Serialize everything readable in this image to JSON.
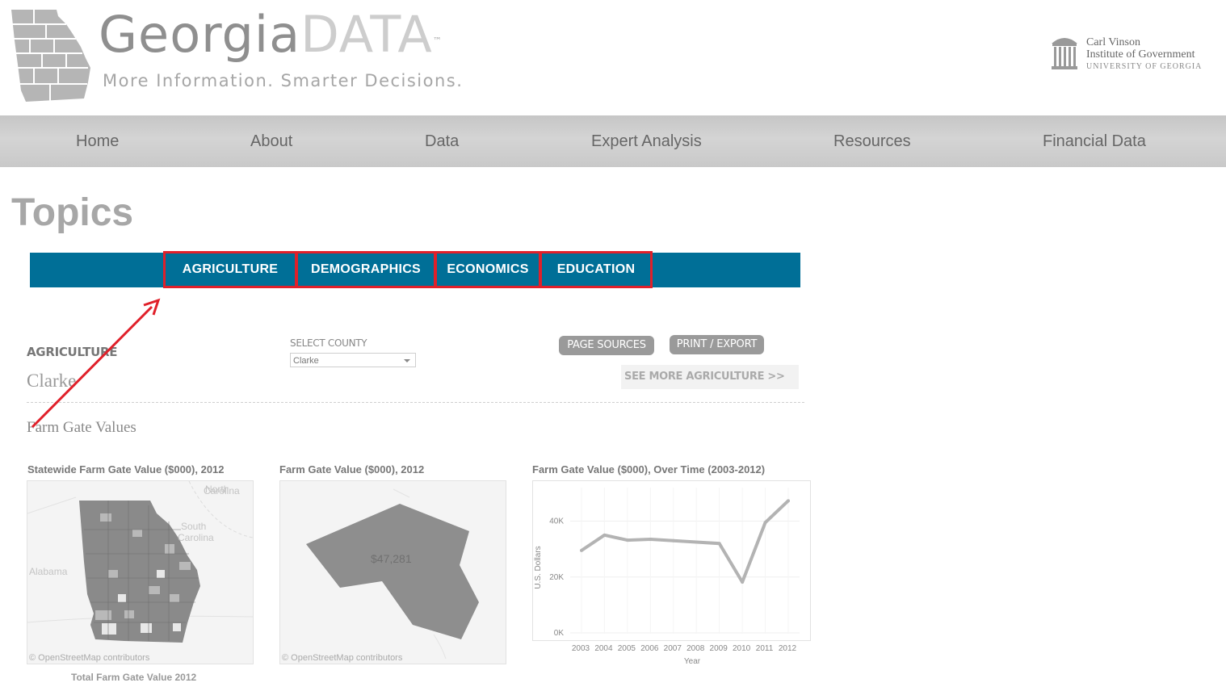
{
  "header": {
    "logo_georgia": "Georgia",
    "logo_data": "DATA",
    "logo_tm": "™",
    "tagline": "More Information. Smarter Decisions.",
    "partner_line1": "Carl Vinson",
    "partner_line2": "Institute of Government",
    "partner_line3": "UNIVERSITY OF GEORGIA"
  },
  "nav": {
    "items": [
      "Home",
      "About",
      "Data",
      "Expert Analysis",
      "Resources",
      "Financial Data"
    ]
  },
  "page_title": "Topics",
  "topic_tabs": [
    "AGRICULTURE",
    "DEMOGRAPHICS",
    "ECONOMICS",
    "EDUCATION"
  ],
  "section": {
    "label": "AGRICULTURE",
    "county": "Clarke",
    "select_label": "SELECT COUNTY",
    "select_value": "Clarke",
    "page_sources": "PAGE SOURCES",
    "print_export": "PRINT / EXPORT",
    "see_more": "SEE MORE AGRICULTURE >>",
    "farm_title": "Farm Gate Values"
  },
  "charts": {
    "statewide_title": "Statewide Farm Gate Value ($000), 2012",
    "county_title": "Farm Gate Value ($000), 2012",
    "time_title": "Farm Gate Value ($000), Over Time (2003-2012)",
    "osm_credit": "© OpenStreetMap contributors",
    "county_value": "$47,281",
    "caption": "Total Farm Gate Value 2012",
    "map_labels": {
      "north_carolina": "North\nCarolina",
      "south_carolina": "South\nCarolina",
      "alabama": "Alabama"
    }
  },
  "chart_data": {
    "type": "line",
    "title": "Farm Gate Value ($000), Over Time (2003-2012)",
    "xlabel": "Year",
    "ylabel": "U.S. Dollars",
    "x": [
      "2003",
      "2004",
      "2005",
      "2006",
      "2007",
      "2008",
      "2009",
      "2010",
      "2011",
      "2012"
    ],
    "y_ticks": [
      "0K",
      "20K",
      "40K"
    ],
    "ylim": [
      0,
      52000
    ],
    "series": [
      {
        "values": [
          29500,
          35000,
          33200,
          33500,
          33000,
          32500,
          32000,
          18200,
          39500,
          47281
        ]
      }
    ],
    "color": "#b3b3b3"
  },
  "colors": {
    "topic_bar": "#006f97",
    "highlight": "#e0202a",
    "nav_bg": "#c9c9c9"
  }
}
